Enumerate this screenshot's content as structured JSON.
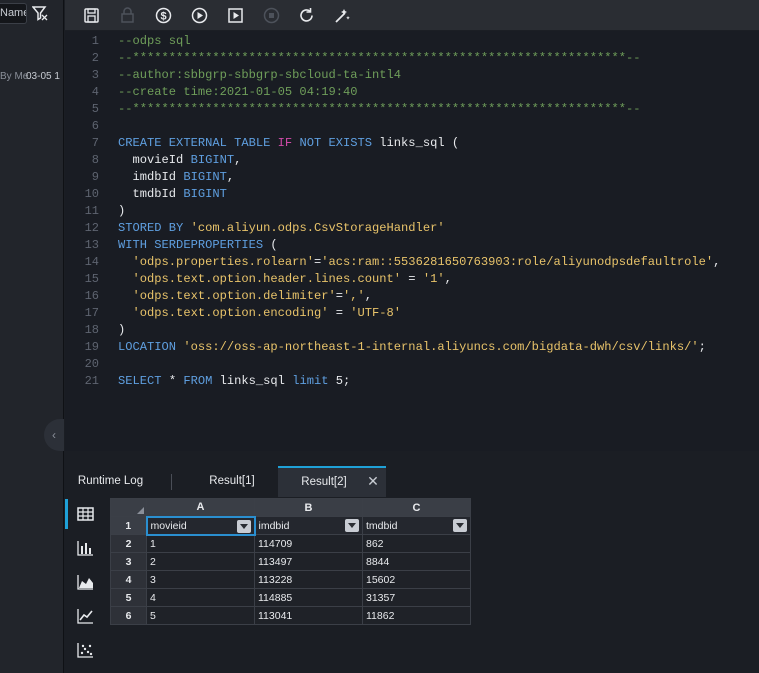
{
  "left_panel": {
    "name_chip": "Name",
    "item_owner": "By Me",
    "item_date": "03-05 1",
    "collapse_glyph": "‹"
  },
  "toolbar": {
    "buttons": [
      {
        "name": "save-icon"
      },
      {
        "name": "lock-icon"
      },
      {
        "name": "cost-estimate-icon"
      },
      {
        "name": "run-icon"
      },
      {
        "name": "run-with-params-icon"
      },
      {
        "name": "stop-icon"
      },
      {
        "name": "reload-icon"
      },
      {
        "name": "format-icon"
      }
    ]
  },
  "editor": {
    "line_numbers": [
      "1",
      "2",
      "3",
      "4",
      "5",
      "6",
      "7",
      "8",
      "9",
      "10",
      "11",
      "12",
      "13",
      "14",
      "15",
      "16",
      "17",
      "18",
      "19",
      "20",
      "21"
    ],
    "lines": [
      [
        {
          "t": "--odps sql",
          "c": "c-comment"
        }
      ],
      [
        {
          "t": "--********************************************************************--",
          "c": "c-comment"
        }
      ],
      [
        {
          "t": "--author:sbbgrp-sbbgrp-sbcloud-ta-intl4",
          "c": "c-comment"
        }
      ],
      [
        {
          "t": "--create time:2021-01-05 04:19:40",
          "c": "c-comment"
        }
      ],
      [
        {
          "t": "--********************************************************************--",
          "c": "c-comment"
        }
      ],
      [],
      [
        {
          "t": "CREATE EXTERNAL TABLE ",
          "c": "c-kw"
        },
        {
          "t": "IF",
          "c": "c-kw2"
        },
        {
          "t": " NOT EXISTS ",
          "c": "c-kw"
        },
        {
          "t": "links_sql (",
          "c": "c-id"
        }
      ],
      [
        {
          "t": "  movieId ",
          "c": "c-id"
        },
        {
          "t": "BIGINT",
          "c": "c-kw"
        },
        {
          "t": ",",
          "c": "c-id"
        }
      ],
      [
        {
          "t": "  imdbId ",
          "c": "c-id"
        },
        {
          "t": "BIGINT",
          "c": "c-kw"
        },
        {
          "t": ",",
          "c": "c-id"
        }
      ],
      [
        {
          "t": "  tmdbId ",
          "c": "c-id"
        },
        {
          "t": "BIGINT",
          "c": "c-kw"
        }
      ],
      [
        {
          "t": ")",
          "c": "c-id"
        }
      ],
      [
        {
          "t": "STORED BY ",
          "c": "c-kw"
        },
        {
          "t": "'com.aliyun.odps.CsvStorageHandler'",
          "c": "c-str"
        }
      ],
      [
        {
          "t": "WITH SERDEPROPERTIES ",
          "c": "c-kw"
        },
        {
          "t": "(",
          "c": "c-id"
        }
      ],
      [
        {
          "t": "  ",
          "c": "c-id"
        },
        {
          "t": "'odps.properties.rolearn'",
          "c": "c-str"
        },
        {
          "t": "=",
          "c": "c-id"
        },
        {
          "t": "'acs:ram::5536281650763903:role/aliyunodpsdefaultrole'",
          "c": "c-str"
        },
        {
          "t": ",",
          "c": "c-id"
        }
      ],
      [
        {
          "t": "  ",
          "c": "c-id"
        },
        {
          "t": "'odps.text.option.header.lines.count'",
          "c": "c-str"
        },
        {
          "t": " = ",
          "c": "c-id"
        },
        {
          "t": "'1'",
          "c": "c-str"
        },
        {
          "t": ",",
          "c": "c-id"
        }
      ],
      [
        {
          "t": "  ",
          "c": "c-id"
        },
        {
          "t": "'odps.text.option.delimiter'",
          "c": "c-str"
        },
        {
          "t": "=",
          "c": "c-id"
        },
        {
          "t": "','",
          "c": "c-str"
        },
        {
          "t": ",",
          "c": "c-id"
        }
      ],
      [
        {
          "t": "  ",
          "c": "c-id"
        },
        {
          "t": "'odps.text.option.encoding'",
          "c": "c-str"
        },
        {
          "t": " = ",
          "c": "c-id"
        },
        {
          "t": "'UTF-8'",
          "c": "c-str"
        }
      ],
      [
        {
          "t": ")",
          "c": "c-id"
        }
      ],
      [
        {
          "t": "LOCATION ",
          "c": "c-kw"
        },
        {
          "t": "'oss://oss-ap-northeast-1-internal.aliyuncs.com/bigdata-dwh/csv/links/'",
          "c": "c-str"
        },
        {
          "t": ";",
          "c": "c-id"
        }
      ],
      [],
      [
        {
          "t": "SELECT ",
          "c": "c-kw"
        },
        {
          "t": "* ",
          "c": "c-id"
        },
        {
          "t": "FROM ",
          "c": "c-kw"
        },
        {
          "t": "links_sql ",
          "c": "c-id"
        },
        {
          "t": "limit ",
          "c": "c-kw"
        },
        {
          "t": "5;",
          "c": "c-id"
        }
      ]
    ]
  },
  "result_tabs": {
    "runtime_log": "Runtime Log",
    "result1": "Result[1]",
    "result2": "Result[2]",
    "close_glyph": "✕"
  },
  "result_views": [
    {
      "name": "table-view-icon"
    },
    {
      "name": "bar-chart-view-icon"
    },
    {
      "name": "area-chart-view-icon"
    },
    {
      "name": "line-chart-view-icon"
    },
    {
      "name": "scatter-chart-view-icon"
    }
  ],
  "grid": {
    "columns": [
      "A",
      "B",
      "C"
    ],
    "row_numbers": [
      "1",
      "2",
      "3",
      "4",
      "5",
      "6"
    ],
    "header_row": [
      "movieid",
      "imdbid",
      "tmdbid"
    ],
    "rows": [
      [
        "1",
        "114709",
        "862"
      ],
      [
        "2",
        "113497",
        "8844"
      ],
      [
        "3",
        "113228",
        "15602"
      ],
      [
        "4",
        "114885",
        "31357"
      ],
      [
        "5",
        "113041",
        "11862"
      ]
    ]
  }
}
